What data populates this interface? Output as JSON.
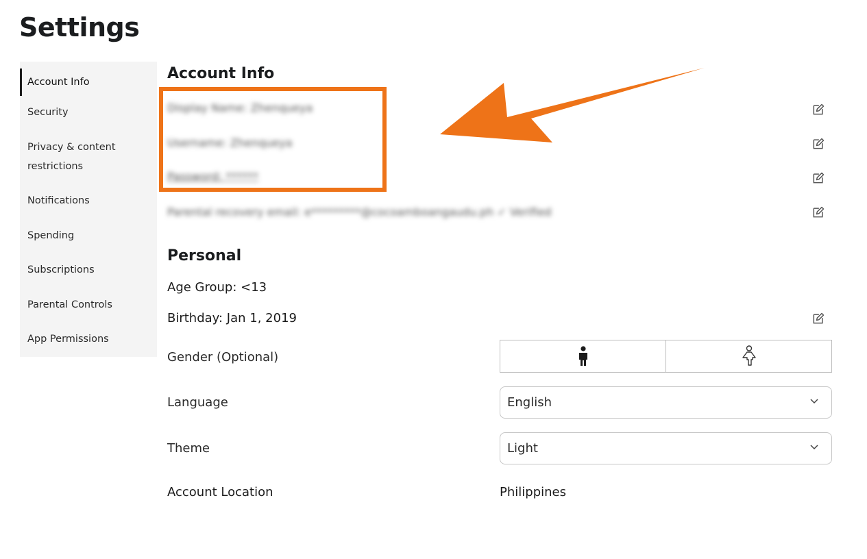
{
  "page": {
    "title": "Settings"
  },
  "sidebar": {
    "items": [
      {
        "label": "Account Info",
        "active": true
      },
      {
        "label": "Security"
      },
      {
        "label": "Privacy & content restrictions"
      },
      {
        "label": "Notifications"
      },
      {
        "label": "Spending"
      },
      {
        "label": "Subscriptions"
      },
      {
        "label": "Parental Controls"
      },
      {
        "label": "App Permissions"
      }
    ]
  },
  "account_info": {
    "title": "Account Info",
    "rows": [
      {
        "text": "Display Name: Zhenqueya"
      },
      {
        "text": "Username: Zhenqueya"
      },
      {
        "text": "Password: ******"
      },
      {
        "text": "Parental recovery email: e*********@cocoamboangaudu.ph   ✓ Verified"
      }
    ]
  },
  "personal": {
    "title": "Personal",
    "age_group": "Age Group: <13",
    "birthday": "Birthday: Jan 1, 2019",
    "gender_label": "Gender (Optional)",
    "language_label": "Language",
    "language_value": "English",
    "theme_label": "Theme",
    "theme_value": "Light",
    "location_label": "Account Location",
    "location_value": "Philippines"
  },
  "icons": {
    "edit": "edit-pencil-icon",
    "male": "male-person-icon",
    "female": "female-person-icon",
    "chevron": "chevron-down-icon"
  },
  "colors": {
    "highlight": "#ee7318",
    "text": "#1b1d1f",
    "sidebar_bg": "#f4f4f4"
  }
}
